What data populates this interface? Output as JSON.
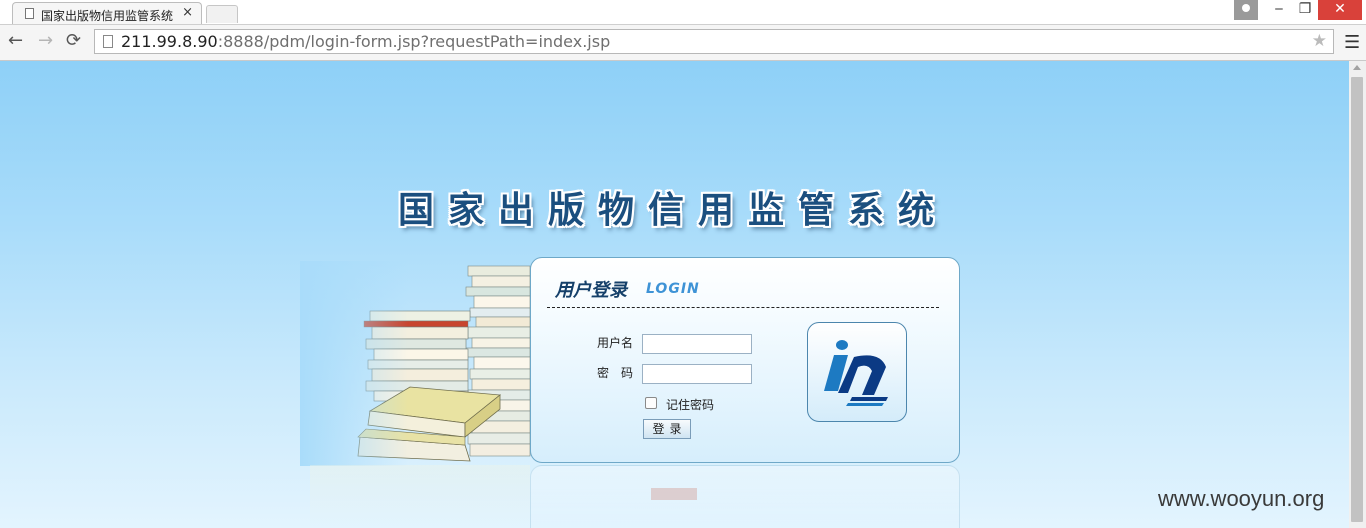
{
  "browser": {
    "tab_title": "国家出版物信用监管系统",
    "tab_close": "×",
    "url_host": "211.99.8.90",
    "url_rest": ":8888/pdm/login-form.jsp?requestPath=index.jsp",
    "icons": {
      "back": "arrow-left",
      "forward": "arrow-right",
      "reload": "reload",
      "bookmark": "star",
      "menu": "hamburger",
      "min": "minimize",
      "restore": "restore",
      "close": "close"
    }
  },
  "page": {
    "system_title": "国家出版物信用监管系统",
    "login": {
      "title": "用户登录",
      "subtitle": "LOGIN",
      "username_label": "用户名",
      "password_label": "密　码",
      "username_value": "",
      "password_value": "",
      "remember_label": "记住密码",
      "remember_checked": false,
      "submit_label": "登录"
    },
    "watermark": "www.wooyun.org"
  },
  "colors": {
    "bg_top": "#8ed0f7",
    "bg_bottom": "#e3f4fe",
    "title": "#1b4f7f",
    "login_sub": "#3e93d6",
    "logo_blue": "#1d7ac2",
    "logo_dark": "#0b3a84"
  }
}
